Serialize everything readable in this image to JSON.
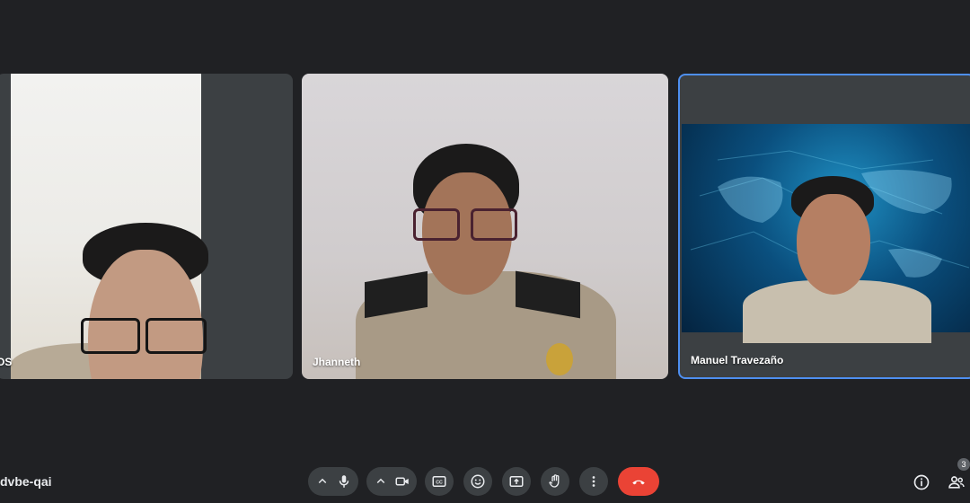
{
  "participants": [
    {
      "name": "OS"
    },
    {
      "name": "Jhanneth"
    },
    {
      "name": "Manuel Travezaño"
    }
  ],
  "meeting": {
    "code": "dvbe-qai"
  },
  "participant_count": "3",
  "icons": {
    "mic": "mic-icon",
    "camera": "camera-icon",
    "captions": "captions-icon",
    "emoji": "emoji-icon",
    "present": "present-icon",
    "raise_hand": "hand-icon",
    "more": "more-icon",
    "end_call": "end-call-icon",
    "info": "info-icon",
    "people": "people-icon"
  },
  "colors": {
    "background": "#202124",
    "control": "#3c4043",
    "end_call": "#ea4335",
    "active_speaker": "#4e8ff0"
  }
}
